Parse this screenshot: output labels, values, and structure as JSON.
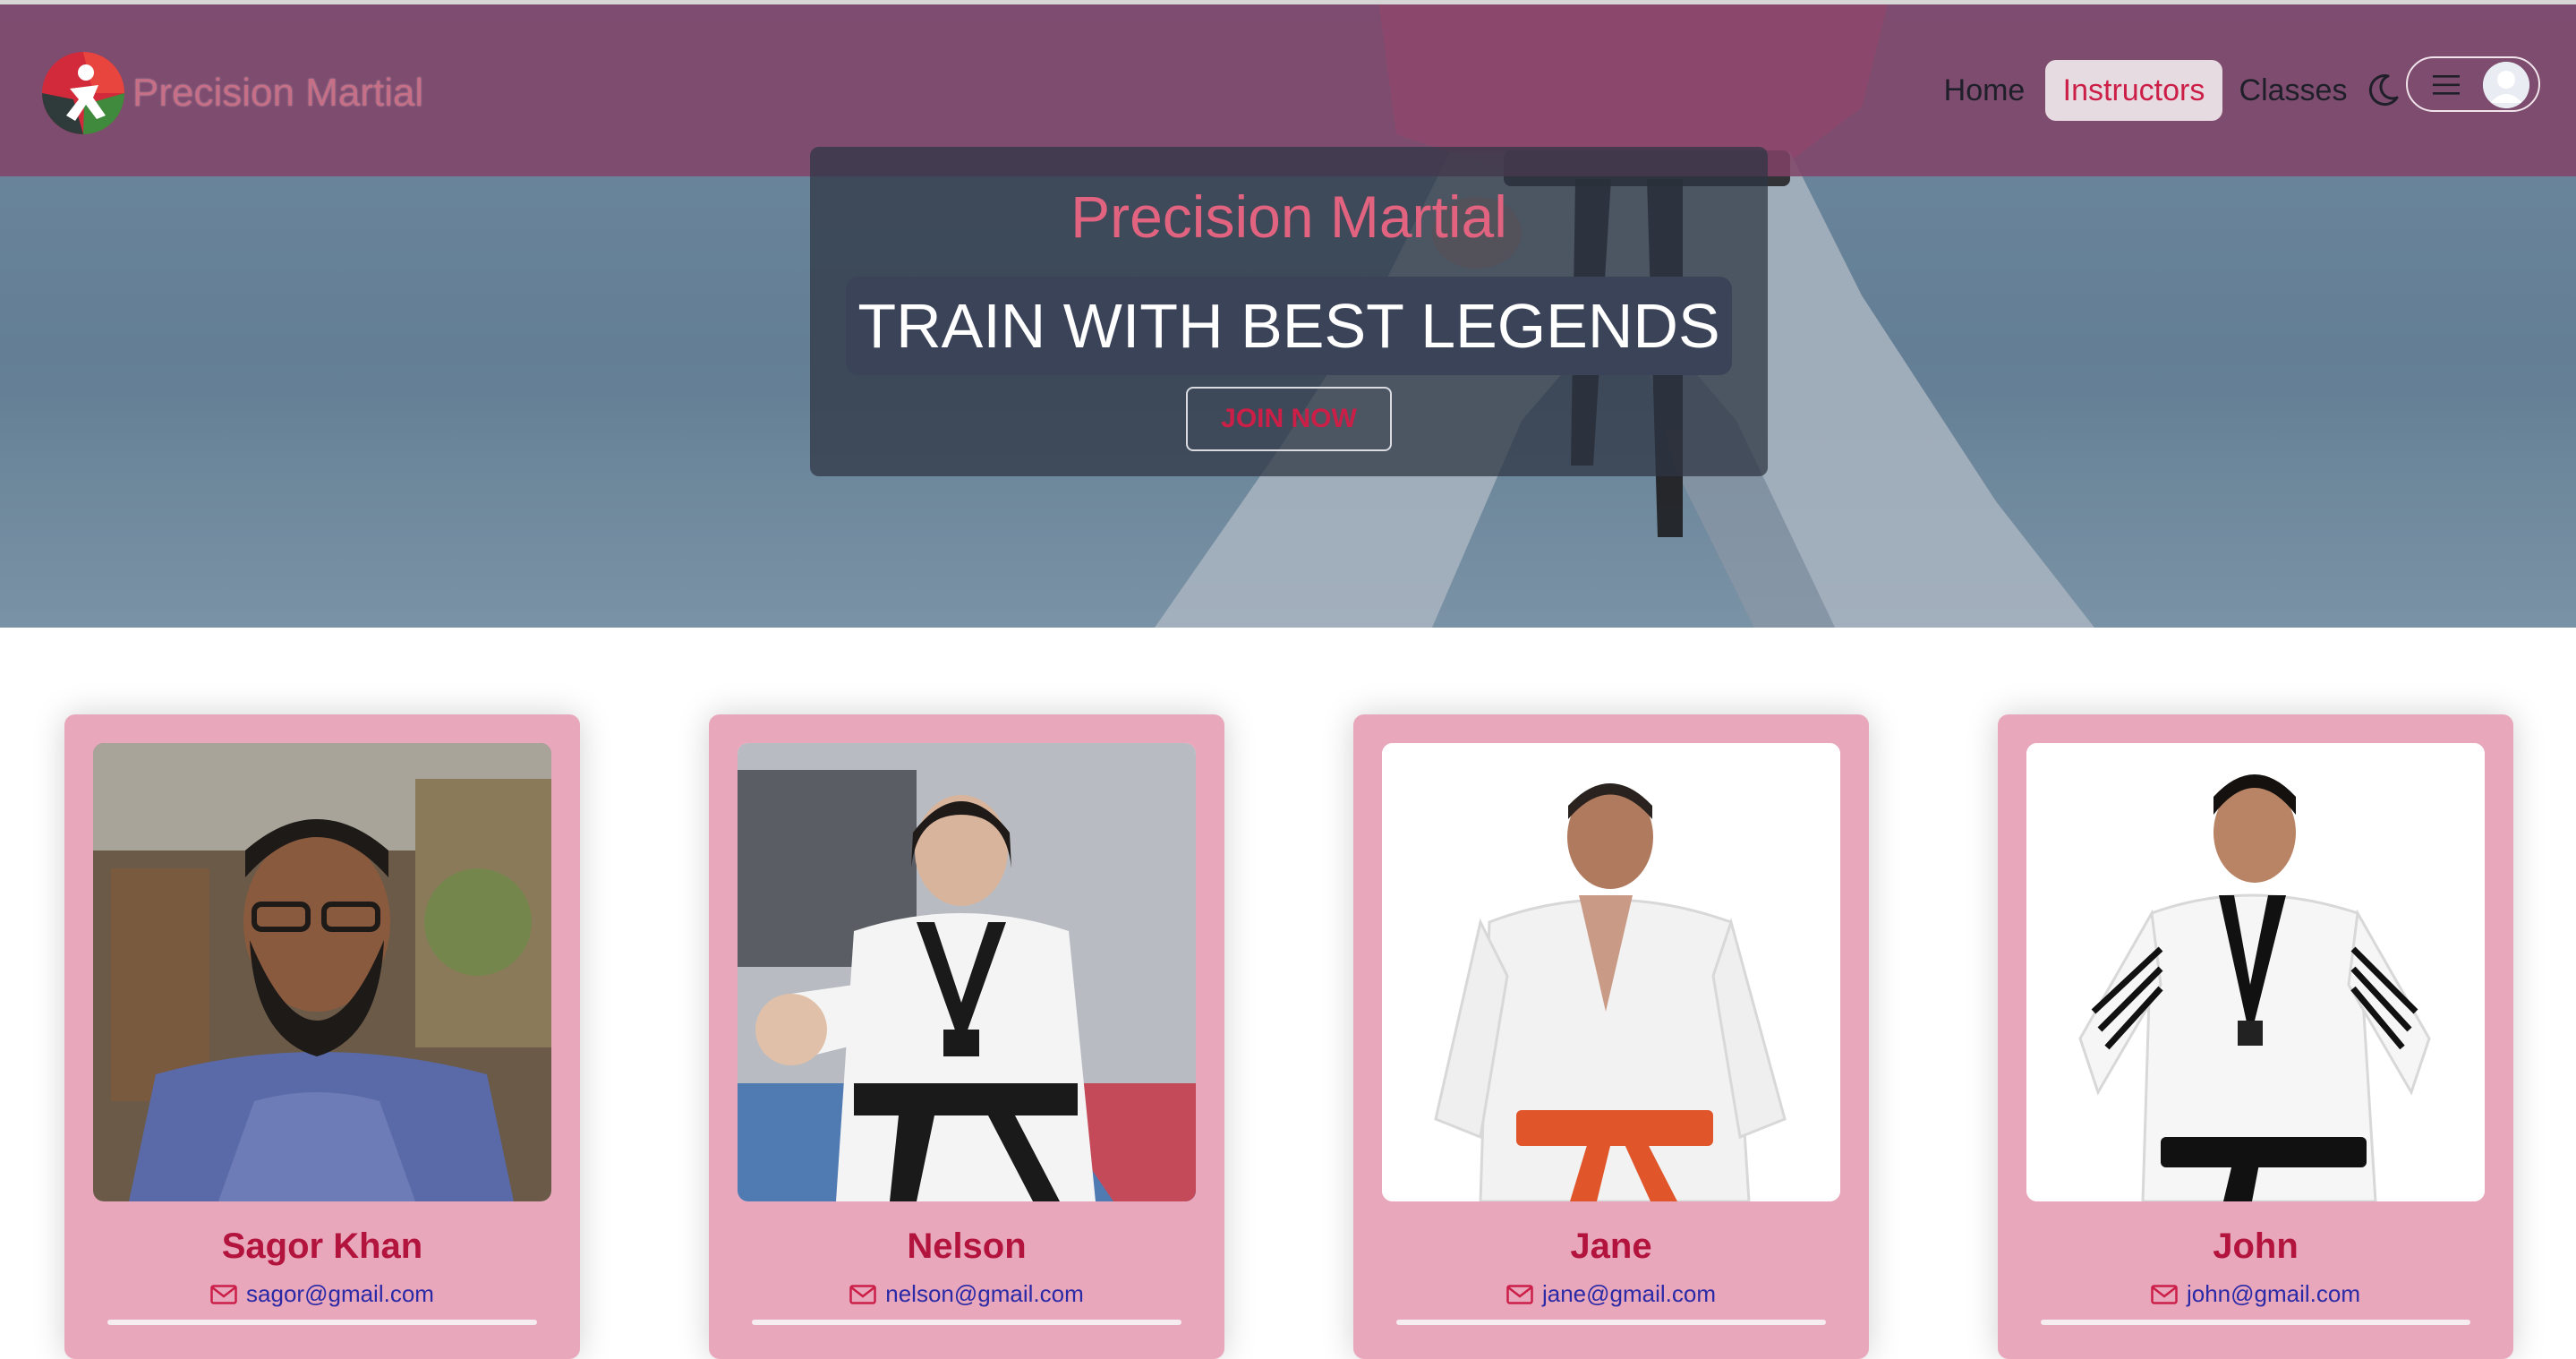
{
  "brand": {
    "name": "Precision Martial"
  },
  "nav": {
    "items": [
      {
        "label": "Home",
        "active": false
      },
      {
        "label": "Instructors",
        "active": true
      },
      {
        "label": "Classes",
        "active": false
      }
    ],
    "theme_toggle_icon": "moon-icon",
    "menu_icon": "hamburger-icon",
    "user_icon": "user-avatar-icon"
  },
  "banner": {
    "title": "Precision Martial",
    "tagline": "TRAIN WITH BEST LEGENDS",
    "cta": "JOIN NOW"
  },
  "instructors": [
    {
      "name": "Sagor Khan",
      "email": "sagor@gmail.com"
    },
    {
      "name": "Nelson",
      "email": "nelson@gmail.com"
    },
    {
      "name": "Jane",
      "email": "jane@gmail.com"
    },
    {
      "name": "John",
      "email": "john@gmail.com"
    }
  ],
  "colors": {
    "accent": "#cc1f48",
    "navbar": "#804268",
    "card": "#e9a7bc",
    "name": "#b3143d",
    "email": "#2a2aa6"
  }
}
